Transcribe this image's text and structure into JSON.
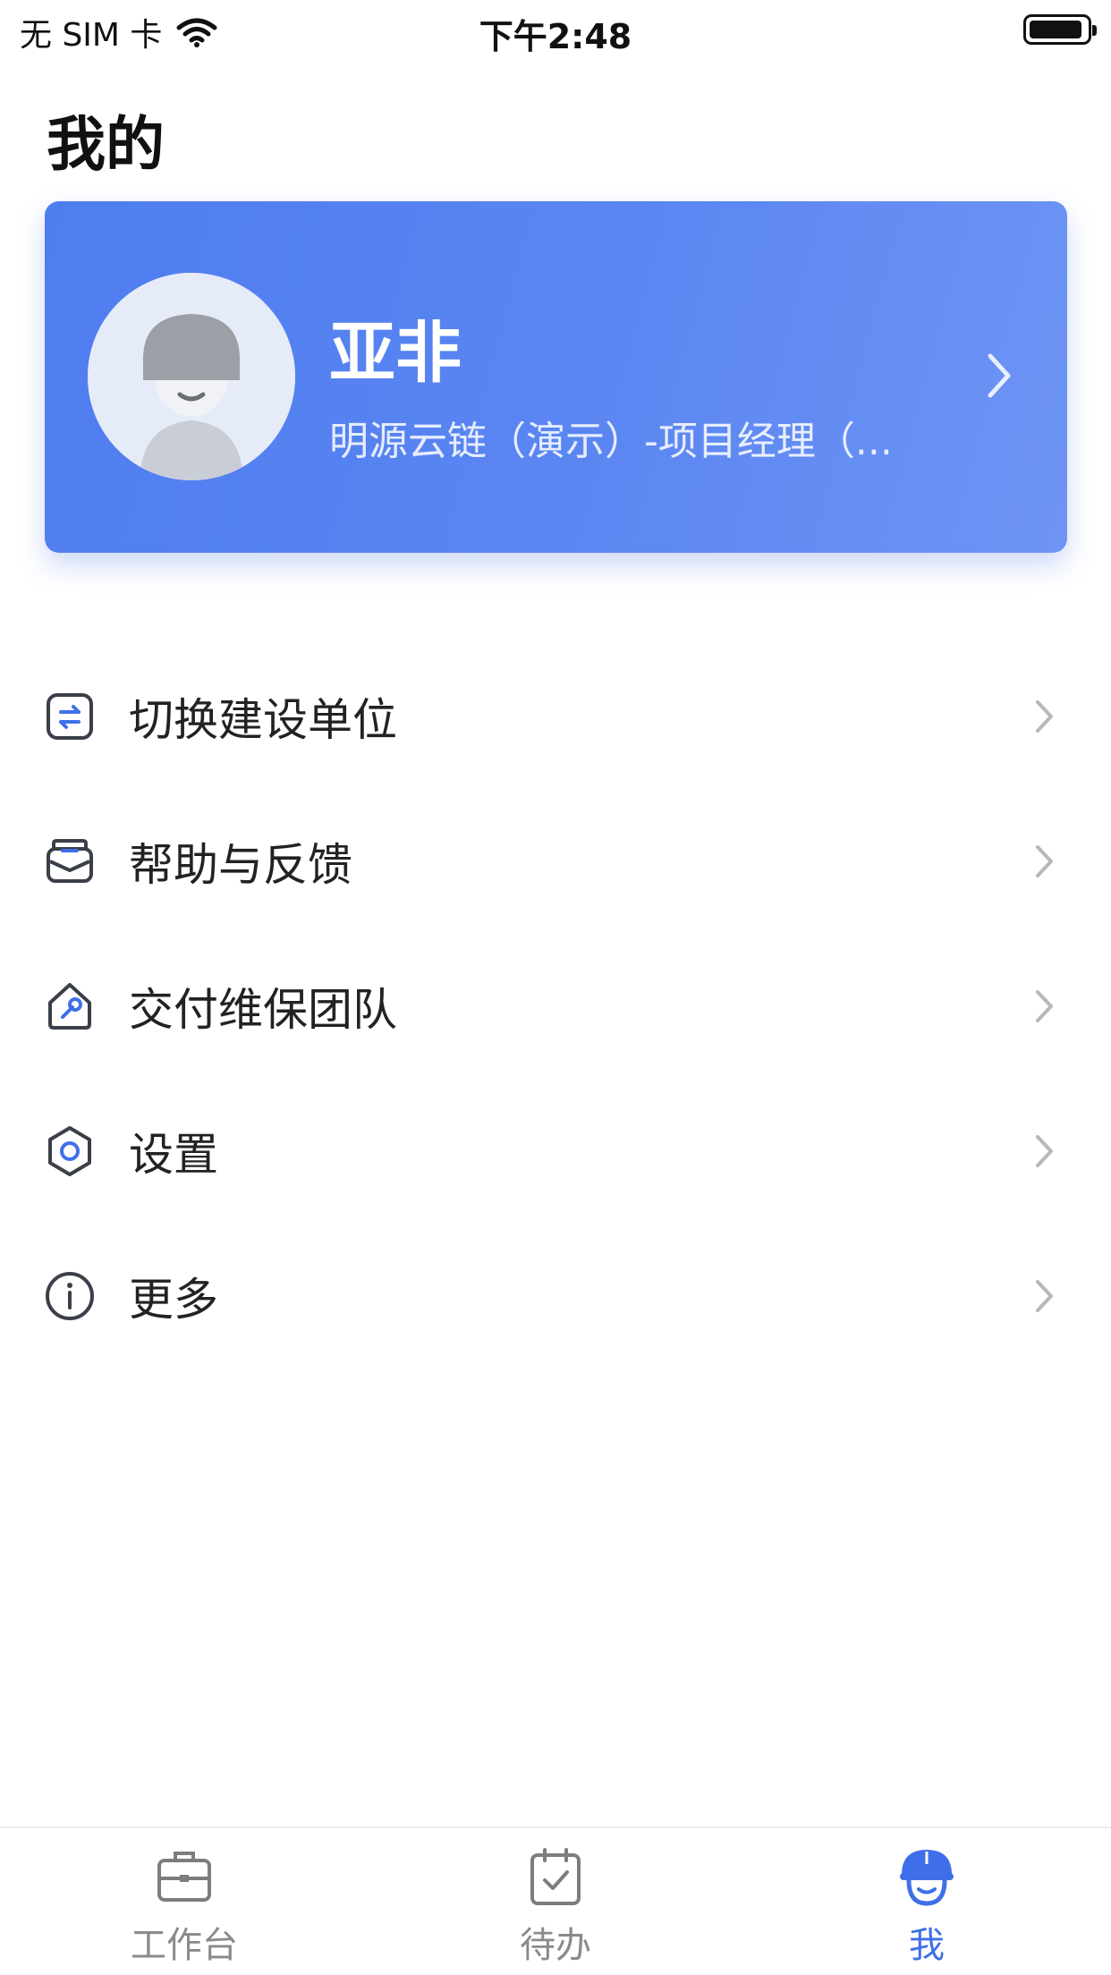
{
  "status_bar": {
    "carrier": "无 SIM 卡",
    "time": "下午2:48"
  },
  "page_title": "我的",
  "profile": {
    "name": "亚非",
    "org": "明源云链（演示）-项目经理（..."
  },
  "menu": [
    {
      "label": "切换建设单位",
      "icon": "switch-icon"
    },
    {
      "label": "帮助与反馈",
      "icon": "feedback-icon"
    },
    {
      "label": "交付维保团队",
      "icon": "maintenance-icon"
    },
    {
      "label": "设置",
      "icon": "settings-icon"
    },
    {
      "label": "更多",
      "icon": "info-icon"
    }
  ],
  "tabbar": {
    "tabs": [
      {
        "label": "工作台",
        "icon": "briefcase-icon",
        "active": false
      },
      {
        "label": "待办",
        "icon": "calendar-check-icon",
        "active": false
      },
      {
        "label": "我",
        "icon": "helmet-user-icon",
        "active": true
      }
    ]
  },
  "colors": {
    "accent": "#3f6fe8",
    "card_start": "#4f7df0",
    "card_end": "#6e95f4",
    "icon_stroke": "#3a3f4a"
  }
}
